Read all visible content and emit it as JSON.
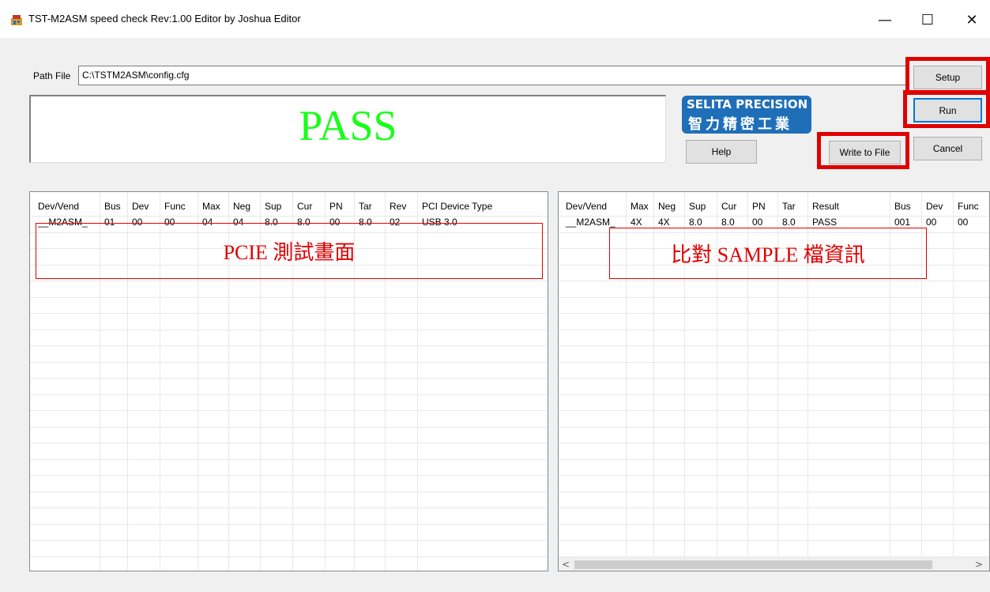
{
  "window": {
    "title": "TST-M2ASM speed  check Rev:1.00 Editor by Joshua Editor",
    "minimize_glyph": "—",
    "maximize_glyph": "☐",
    "close_glyph": "✕"
  },
  "path": {
    "label": "Path File",
    "value": "C:\\TSTM2ASM\\config.cfg"
  },
  "buttons": {
    "setup": "Setup",
    "run": "Run",
    "cancel": "Cancel",
    "help": "Help",
    "write_to_file": "Write to File"
  },
  "result": {
    "text": "PASS",
    "color": "#17ff17"
  },
  "logo": {
    "line1": "SELITA PRECISION",
    "line2": "智力精密工業",
    "color": "#1f6fb8"
  },
  "left_table": {
    "headers": [
      "Dev/Vend",
      "Bus",
      "Dev",
      "Func",
      "Max",
      "Neg",
      "Sup",
      "Cur",
      "PN",
      "Tar",
      "Rev",
      "PCI Device Type"
    ],
    "rows": [
      [
        "__M2ASM_",
        "01",
        "00",
        "00",
        "04",
        "04",
        "8.0",
        "8.0",
        "00",
        "8.0",
        "02",
        "USB 3.0"
      ]
    ]
  },
  "right_table": {
    "headers": [
      "Dev/Vend",
      "Max",
      "Neg",
      "Sup",
      "Cur",
      "PN",
      "Tar",
      "Result",
      "Bus",
      "Dev",
      "Func"
    ],
    "rows": [
      [
        "__M2ASM_",
        "4X",
        "4X",
        "8.0",
        "8.0",
        "00",
        "8.0",
        "PASS",
        "001",
        "00",
        "00"
      ]
    ]
  },
  "annotations": {
    "left": "PCIE 測試畫面",
    "right": "比對 SAMPLE 檔資訊",
    "highlight_color": "#e00000"
  },
  "scrollbar": {
    "left_arrow": "<",
    "right_arrow": ">"
  }
}
